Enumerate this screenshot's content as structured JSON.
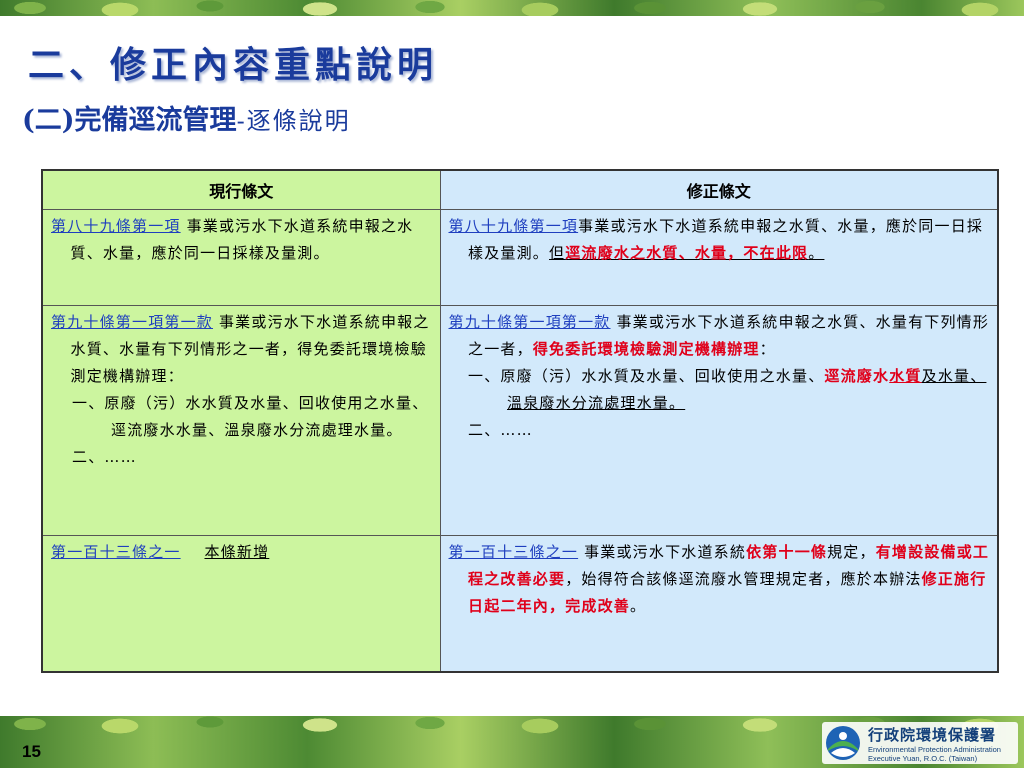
{
  "slide": {
    "title": "二、修正內容重點說明",
    "subtitle_main": "(二)完備逕流管理",
    "subtitle_sub": "-逐條說明",
    "page_number": "15"
  },
  "table": {
    "headers": {
      "left": "現行條文",
      "right": "修正條文"
    },
    "row1": {
      "left_ref": "第八十九條第一項",
      "left_text": " 事業或污水下水道系統申報之水質、水量，應於同一日採樣及量測。",
      "right_ref": "第八十九條第一項",
      "right_text": "事業或污水下水道系統申報之水質、水量，應於同一日採樣及量測。",
      "right_but": "但",
      "right_red": "逕流廢水之水質、水量，不在此限",
      "right_end": "。"
    },
    "row2": {
      "left_ref": "第九十條第一項第一款",
      "left_text": "  事業或污水下水道系統申報之水質、水量有下列情形之一者，得免委託環境檢驗測定機構辦理：",
      "left_item1": "一、原廢（污）水水質及水量、回收使用之水量、逕流廢水水量、溫泉廢水分流處理水量。",
      "left_item2": "二、……",
      "right_ref": "第九十條第一項第一款",
      "right_text": " 事業或污水下水道系統申報之水質、水量有下列情形之一者，",
      "right_red": "得免委託環境檢驗測定機構辦理",
      "right_colon": "：",
      "right_item1a": "一、原廢（污）水水質及水量、回收使用之水量、",
      "right_item1_red1": "逕流廢水",
      "right_item1_red2": "水質",
      "right_item1b": "及水量、溫泉廢水分流處理水量。",
      "right_item2": "二、……"
    },
    "row3": {
      "left_ref": "第一百十三條之一",
      "left_text": "本條新增",
      "right_ref": "第一百十三條之一",
      "right_t1": "  事業或污水下水道系統",
      "right_r1": "依第十一條",
      "right_t2": "規定，",
      "right_r2": "有增設設備或工程之改善必要",
      "right_t3": "，始得符合該條逕流廢水管理規定者，應於本辦法",
      "right_r3": "修正施行日起二年內，完成改善",
      "right_t4": "。"
    }
  },
  "footer": {
    "org_name_cn": "行政院環境保護署",
    "org_name_en_1": "Environmental Protection Administration",
    "org_name_en_2": "Executive Yuan, R.O.C. (Taiwan)",
    "logo_icon": "epa-logo-icon"
  }
}
